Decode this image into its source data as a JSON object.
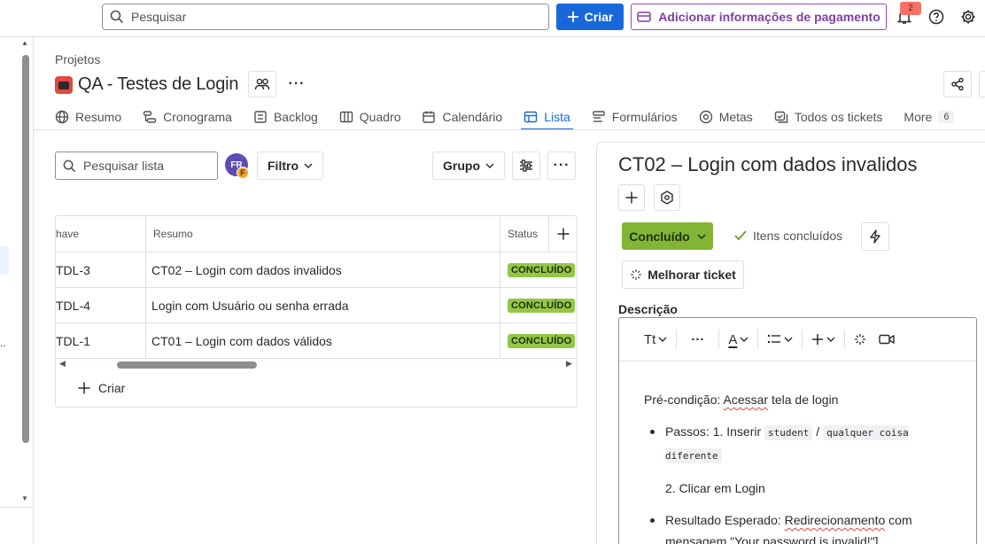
{
  "topbar": {
    "search_placeholder": "Pesquisar",
    "create_label": "Criar",
    "payment_label": "Adicionar informações de pagamento",
    "notification_count": "2"
  },
  "header": {
    "breadcrumb": "Projetos",
    "project_title": "QA - Testes de Login"
  },
  "tabs": [
    {
      "label": "Resumo",
      "icon": "globe-icon"
    },
    {
      "label": "Cronograma",
      "icon": "timeline-icon"
    },
    {
      "label": "Backlog",
      "icon": "backlog-icon"
    },
    {
      "label": "Quadro",
      "icon": "board-icon"
    },
    {
      "label": "Calendário",
      "icon": "calendar-icon"
    },
    {
      "label": "Lista",
      "icon": "list-icon",
      "active": true
    },
    {
      "label": "Formulários",
      "icon": "forms-icon"
    },
    {
      "label": "Metas",
      "icon": "goals-icon"
    },
    {
      "label": "Todos os tickets",
      "icon": "tickets-icon"
    },
    {
      "label": "More",
      "count": "6"
    }
  ],
  "list": {
    "search_placeholder": "Pesquisar lista",
    "avatar_initials": "FR",
    "avatar_sub": "F",
    "filter_label": "Filtro",
    "group_label": "Grupo",
    "columns": {
      "key": "have",
      "summary": "Resumo",
      "status": "Status"
    },
    "rows": [
      {
        "key": "TDL-3",
        "summary": "CT02 – Login com dados invalidos",
        "status": "CONCLUÍDO"
      },
      {
        "key": "TDL-4",
        "summary": "Login com Usuário ou senha errada",
        "status": "CONCLUÍDO"
      },
      {
        "key": "TDL-1",
        "summary": "CT01 – Login com dados válidos",
        "status": "CONCLUÍDO"
      }
    ],
    "create_label": "Criar"
  },
  "ticket": {
    "title": "CT02 – Login com dados invalidos",
    "status_button": "Concluído",
    "done_items": "Itens concluídos",
    "improve_label": "Melhorar ticket",
    "description_label": "Descrição",
    "toolbar": {
      "text_style": "Tt",
      "more": "···",
      "text_color": "A"
    },
    "body": {
      "precondition_prefix": "Pré-condição: ",
      "precondition_word": "Acessar",
      "precondition_suffix": " tela de login",
      "steps_prefix": "Passos: 1. Inserir ",
      "code1": "student",
      "slash": " / ",
      "code2": "qualquer coisa diferente",
      "step2": "2. Clicar em Login",
      "expected_prefix": "Resultado Esperado: ",
      "expected_word": "Redirecionamento",
      "expected_suffix": " com",
      "expected_line2": "mensagem \"Your password is invalid!\"]"
    }
  }
}
